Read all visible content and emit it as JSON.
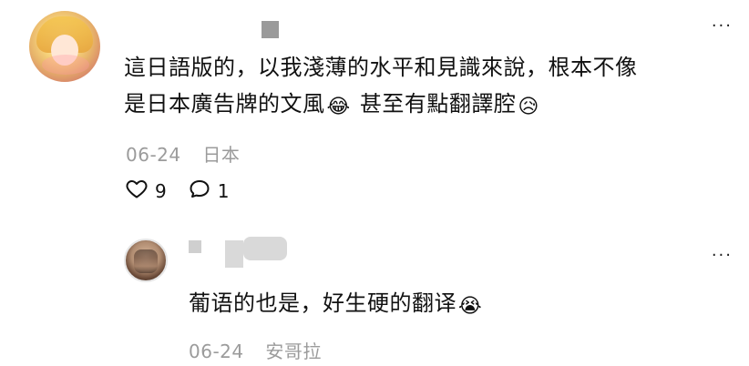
{
  "comment": {
    "text_line_1": "這日語版的，以我淺薄的水平和見識來說，根本不像",
    "text_line_2_a": "是日本廣告牌的文風",
    "emoji_1": "😂",
    "text_line_2_b": " 甚至有點翻譯腔",
    "emoji_2": "😥",
    "date": "06-24",
    "location": "日本",
    "likes": "9",
    "replies": "1",
    "more_label": "···",
    "icons": {
      "like": "heart-outline-icon",
      "reply": "speech-bubble-outline-icon",
      "more": "more-icon"
    }
  },
  "reply": {
    "text": "葡语的也是，好生硬的翻译",
    "emoji": "😭",
    "date": "06-24",
    "location": "安哥拉",
    "more_label": "···"
  }
}
